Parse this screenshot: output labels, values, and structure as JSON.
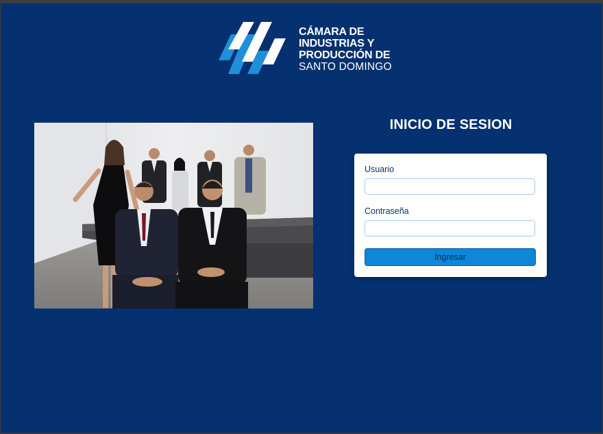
{
  "brand": {
    "logo_icon": "cips-stripes-logo",
    "name_lines": [
      "CÁMARA DE",
      "INDUSTRIAS Y",
      "PRODUCCIÓN DE",
      "SANTO DOMINGO"
    ]
  },
  "hero_photo": {
    "alt": "team-group-photo"
  },
  "login": {
    "title": "INICIO DE SESION",
    "username_label": "Usuario",
    "username_value": "",
    "password_label": "Contraseña",
    "password_value": "",
    "submit_label": "Ingresar"
  },
  "colors": {
    "page_background": "#053170",
    "button": "#0f86d8",
    "label_text": "#0a2f6b",
    "input_border": "#a9c9ef"
  }
}
